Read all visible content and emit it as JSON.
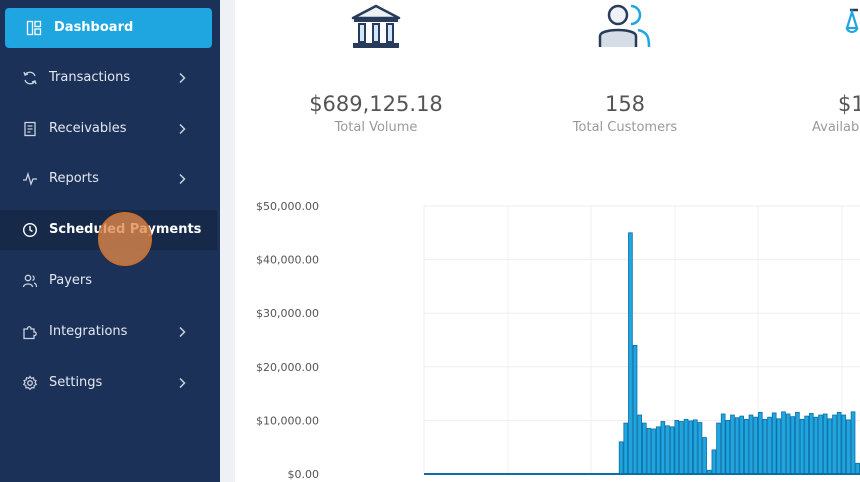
{
  "sidebar": {
    "items": [
      {
        "label": "Dashboard",
        "icon": "dashboard-icon",
        "chevron": false
      },
      {
        "label": "Transactions",
        "icon": "refresh-icon",
        "chevron": true
      },
      {
        "label": "Receivables",
        "icon": "receipt-icon",
        "chevron": true
      },
      {
        "label": "Reports",
        "icon": "activity-icon",
        "chevron": true
      },
      {
        "label": "Scheduled Payments",
        "icon": "clock-icon",
        "chevron": false
      },
      {
        "label": "Payers",
        "icon": "users-icon",
        "chevron": false
      },
      {
        "label": "Integrations",
        "icon": "puzzle-icon",
        "chevron": true
      },
      {
        "label": "Settings",
        "icon": "gear-icon",
        "chevron": true
      }
    ]
  },
  "stats": [
    {
      "value": "$689,125.18",
      "caption": "Total Volume",
      "icon": "bank-icon"
    },
    {
      "value": "158",
      "caption": "Total Customers",
      "icon": "customers-icon"
    },
    {
      "value": "$1",
      "caption": "Availab",
      "icon": "scale-icon"
    }
  ],
  "colors": {
    "sidebar_bg": "#1c3157",
    "active_item": "#1fa6e0",
    "bar_fill": "#1fa6e0",
    "bar_stroke": "#0b6fa6"
  },
  "chart_data": {
    "type": "bar",
    "yticks": [
      "$50,000.00",
      "$40,000.00",
      "$30,000.00",
      "$20,000.00",
      "$10,000.00",
      "$0.00"
    ],
    "ylim": [
      0,
      50000
    ],
    "values": [
      0,
      0,
      0,
      0,
      0,
      0,
      0,
      0,
      0,
      0,
      0,
      0,
      0,
      0,
      0,
      0,
      0,
      0,
      0,
      0,
      0,
      0,
      0,
      0,
      0,
      0,
      0,
      0,
      0,
      0,
      0,
      0,
      0,
      0,
      0,
      0,
      0,
      0,
      0,
      0,
      0,
      0,
      6000,
      9500,
      45000,
      24000,
      11000,
      9500,
      8500,
      8400,
      8800,
      9800,
      9000,
      8800,
      10000,
      9800,
      10200,
      9900,
      10100,
      9600,
      6800,
      700,
      4500,
      9500,
      11200,
      10000,
      11000,
      10500,
      10800,
      10200,
      11000,
      10600,
      11500,
      10200,
      10600,
      11400,
      10300,
      11600,
      11200,
      10700,
      11500,
      10200,
      10800,
      11300,
      10600,
      11000,
      11200,
      10300,
      11000,
      11500,
      11000,
      10100,
      11600,
      2000
    ]
  }
}
